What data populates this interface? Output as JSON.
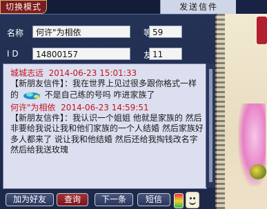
{
  "topbar": {
    "mode_button": "切换模式",
    "title": "发送信件"
  },
  "info": {
    "name_label": "名称",
    "name_value": "何许\"为相依",
    "level_label": "等级",
    "level_value": "59",
    "id_label": "I D",
    "id_value": "14800157",
    "friendship_label": "友好",
    "friendship_value": "11"
  },
  "messages": [
    {
      "sender": "城城志远",
      "timestamp": "2014-06-23 15:01:33",
      "lines_before_icon": "【新朋友信件】：我在世界上见过很多跟你格式一样的",
      "lines_after_icon": "不是自己练的号吗 咋进家族了"
    },
    {
      "sender": "何许\"为相依",
      "timestamp": "2014-06-23 14:59:51",
      "body": "【新朋友信件】：我认识一个姐姐 他就是家族的 然后非要给我说让我和他们家族的一个人结婚 然后家族好多人都来了 说让我和他结婚 然后还给我掏钱改名字 然后给我送玫瑰"
    }
  ],
  "buttons": {
    "add_friend": "加为好友",
    "query": "查询",
    "next": "下一条",
    "sms": "短信"
  },
  "colors": {
    "header_red": "#c4141b",
    "active_button": "#a53036"
  },
  "icons": {
    "message_gem": "blue-green-gem-icon",
    "emoji": "smiley-face-icon",
    "meter": "signal-meter-icon"
  }
}
